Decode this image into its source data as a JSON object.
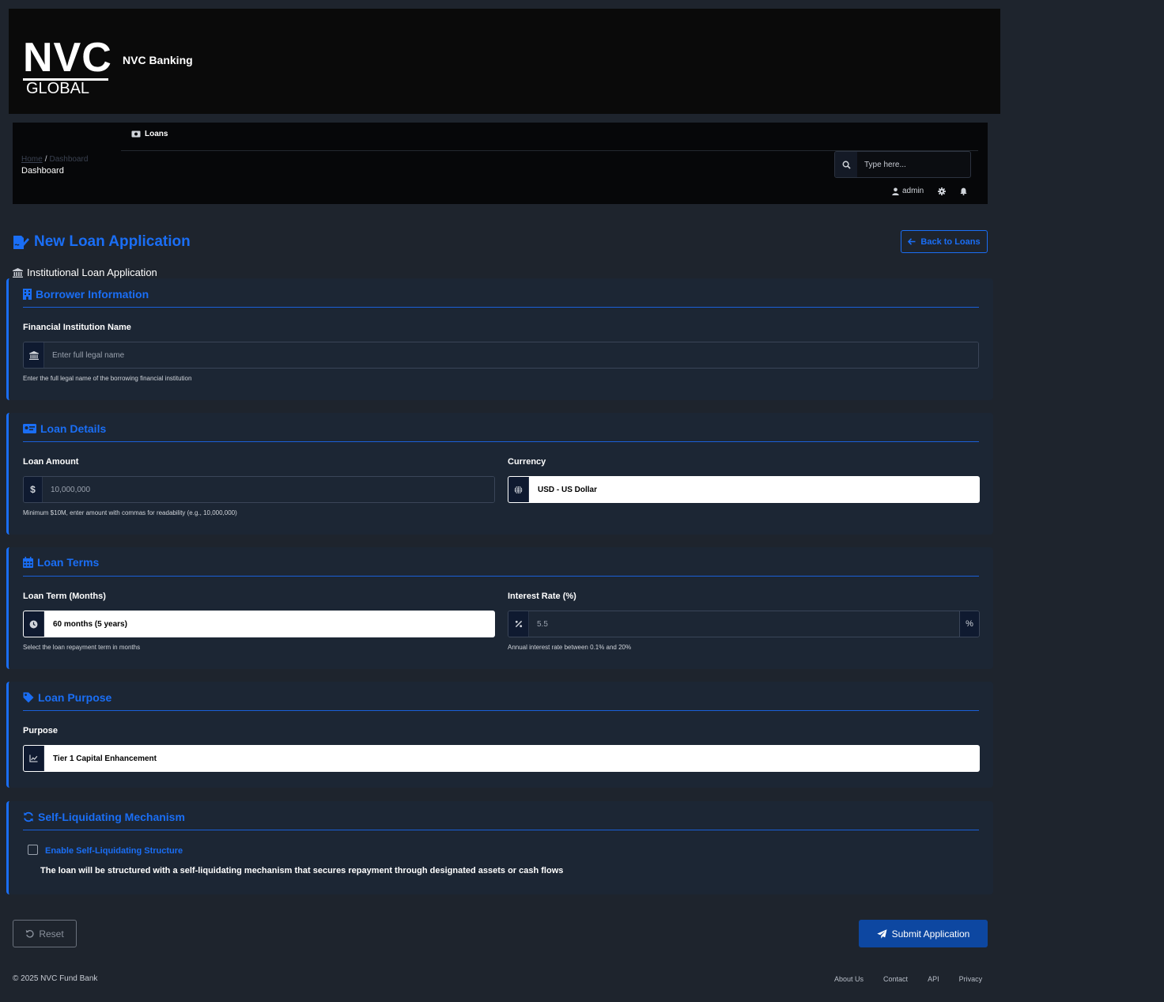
{
  "brand": {
    "logo_main": "NVC",
    "logo_sub": "GLOBAL",
    "name": "NVC Banking"
  },
  "nav": {
    "loans_label": "Loans"
  },
  "breadcrumb": {
    "home": "Home",
    "separator": "/",
    "current": "Dashboard",
    "title": "Dashboard"
  },
  "search": {
    "placeholder": "Type here..."
  },
  "user": {
    "name": "admin"
  },
  "page": {
    "title": "New Loan Application",
    "back_label": "Back to Loans",
    "subtitle": "Institutional Loan Application"
  },
  "borrower": {
    "title": "Borrower Information",
    "institution_label": "Financial Institution Name",
    "institution_placeholder": "Enter full legal name",
    "institution_help": "Enter the full legal name of the borrowing financial institution"
  },
  "loan_details": {
    "title": "Loan Details",
    "amount_label": "Loan Amount",
    "amount_prefix": "$",
    "amount_placeholder": "10,000,000",
    "amount_help": "Minimum $10M, enter amount with commas for readability (e.g., 10,000,000)",
    "currency_label": "Currency",
    "currency_value": "USD - US Dollar"
  },
  "loan_terms": {
    "title": "Loan Terms",
    "term_label": "Loan Term (Months)",
    "term_value": "60 months (5 years)",
    "term_help": "Select the loan repayment term in months",
    "rate_label": "Interest Rate (%)",
    "rate_placeholder": "5.5",
    "rate_suffix": "%",
    "rate_help": "Annual interest rate between 0.1% and 20%"
  },
  "loan_purpose": {
    "title": "Loan Purpose",
    "purpose_label": "Purpose",
    "purpose_value": "Tier 1 Capital Enhancement"
  },
  "self_liquidating": {
    "title": "Self-Liquidating Mechanism",
    "checkbox_label": "Enable Self-Liquidating Structure",
    "checked": false,
    "description": "The loan will be structured with a self-liquidating mechanism that secures repayment through designated assets or cash flows"
  },
  "actions": {
    "reset_label": "Reset",
    "submit_label": "Submit Application"
  },
  "footer": {
    "copyright": "© 2025 NVC Fund Bank",
    "links": [
      "About Us",
      "Contact",
      "API",
      "Privacy"
    ]
  },
  "colors": {
    "accent": "#1a6ef5",
    "background": "#1e242d",
    "card": "#1c2634",
    "submit": "#0d47a1"
  }
}
